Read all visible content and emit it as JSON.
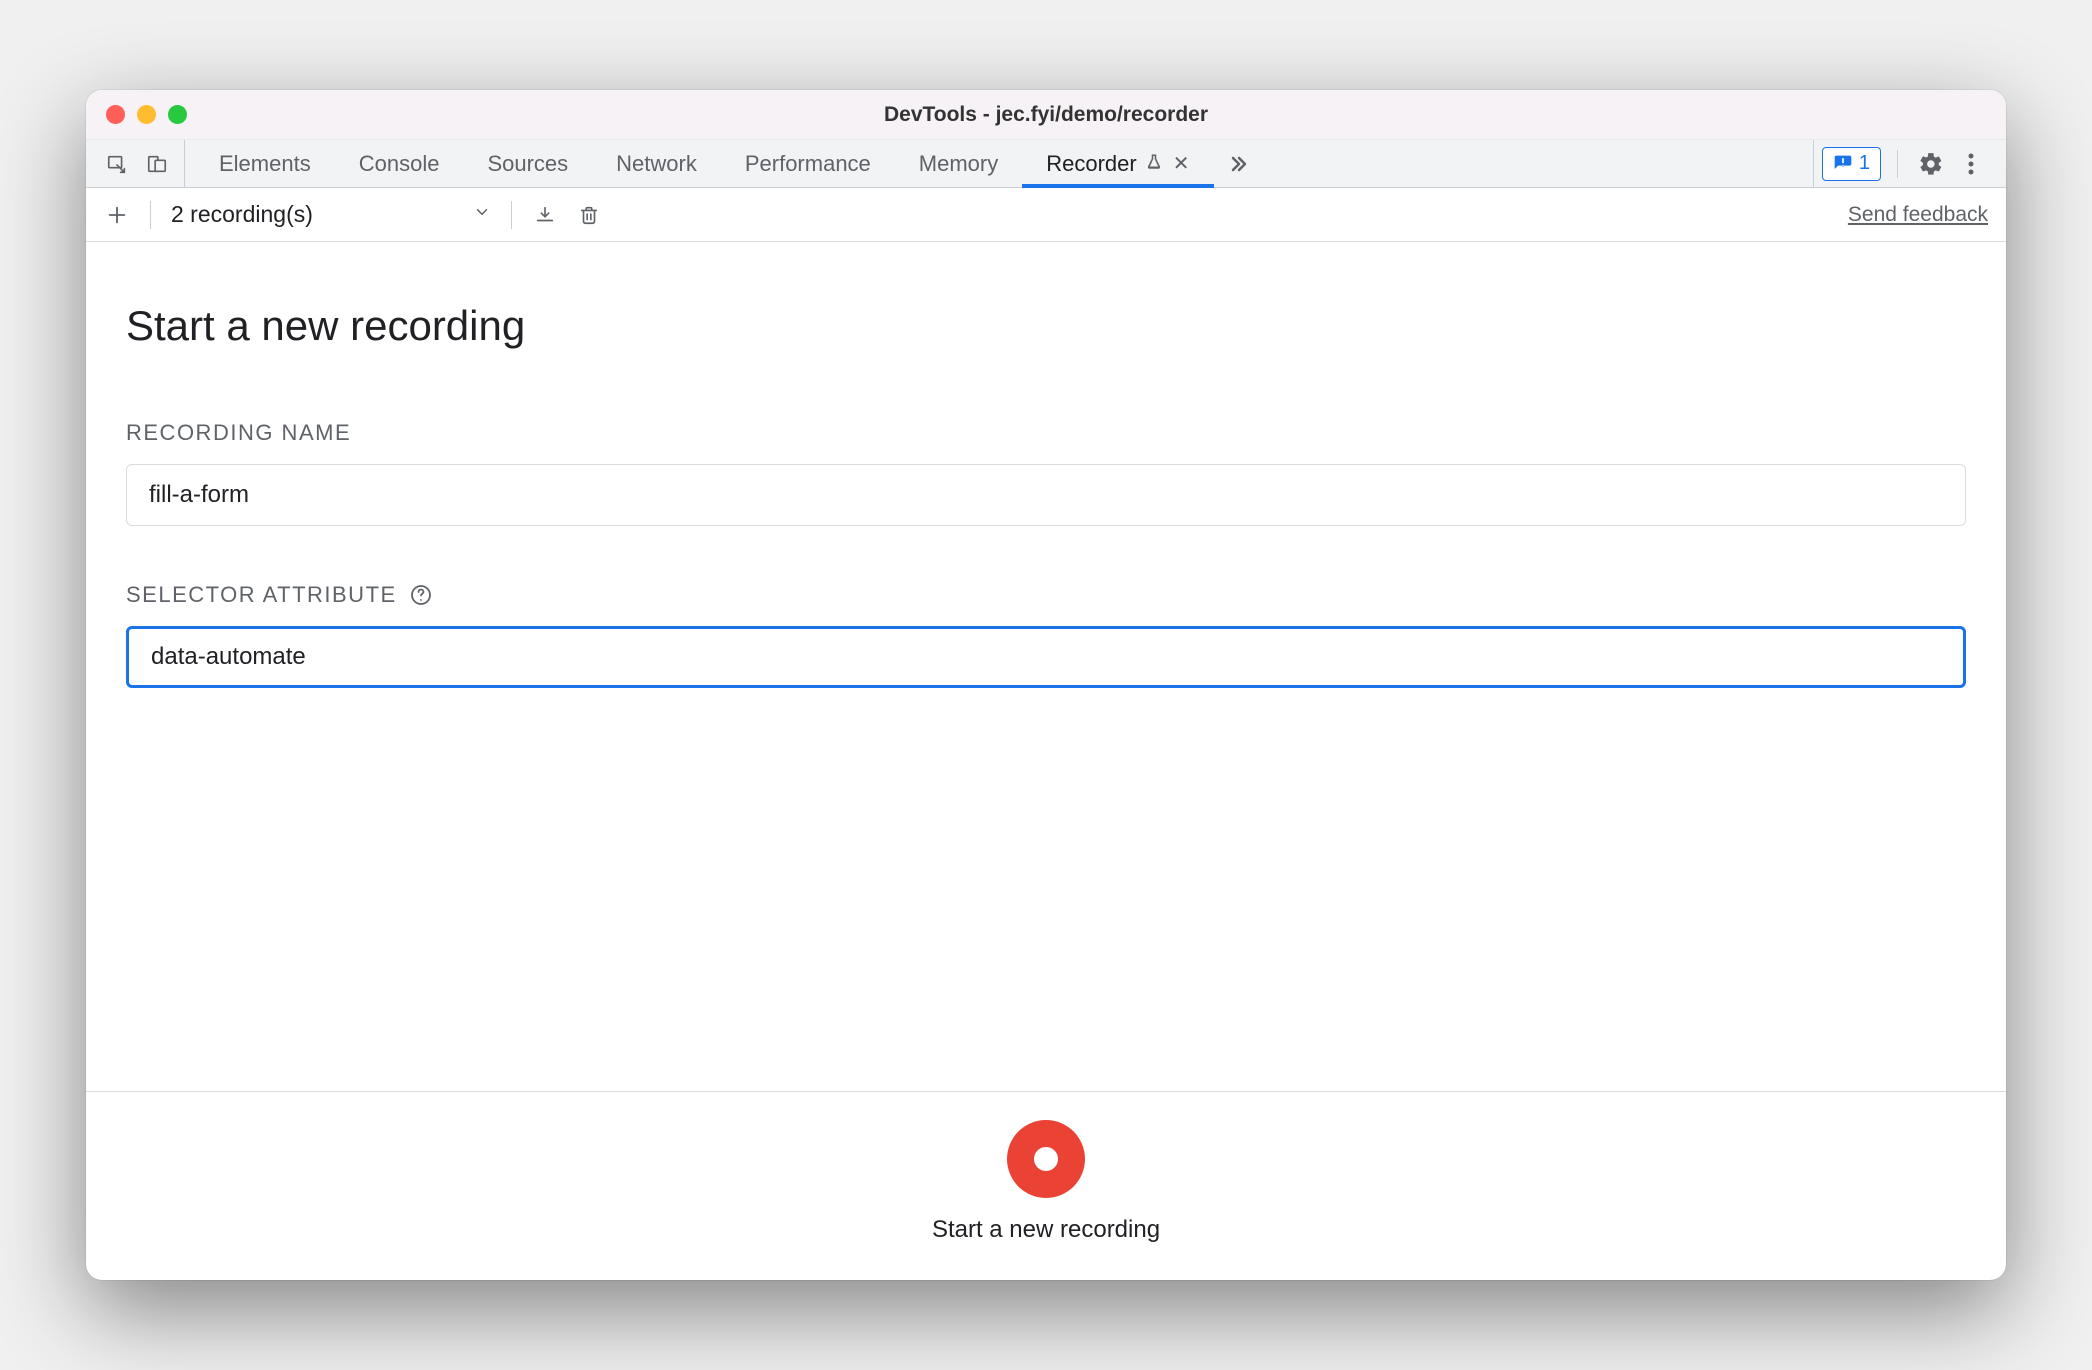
{
  "window": {
    "title": "DevTools - jec.fyi/demo/recorder"
  },
  "tabs": {
    "items": [
      {
        "label": "Elements",
        "active": false
      },
      {
        "label": "Console",
        "active": false
      },
      {
        "label": "Sources",
        "active": false
      },
      {
        "label": "Network",
        "active": false
      },
      {
        "label": "Performance",
        "active": false
      },
      {
        "label": "Memory",
        "active": false
      },
      {
        "label": "Recorder",
        "active": true
      }
    ],
    "issues_count": "1"
  },
  "toolbar": {
    "dropdown_label": "2 recording(s)",
    "feedback_link": "Send feedback"
  },
  "page": {
    "title": "Start a new recording",
    "recording_name_label": "Recording Name",
    "recording_name_value": "fill-a-form",
    "selector_attribute_label": "Selector Attribute",
    "selector_attribute_value": "data-automate"
  },
  "footer": {
    "record_caption": "Start a new recording"
  }
}
